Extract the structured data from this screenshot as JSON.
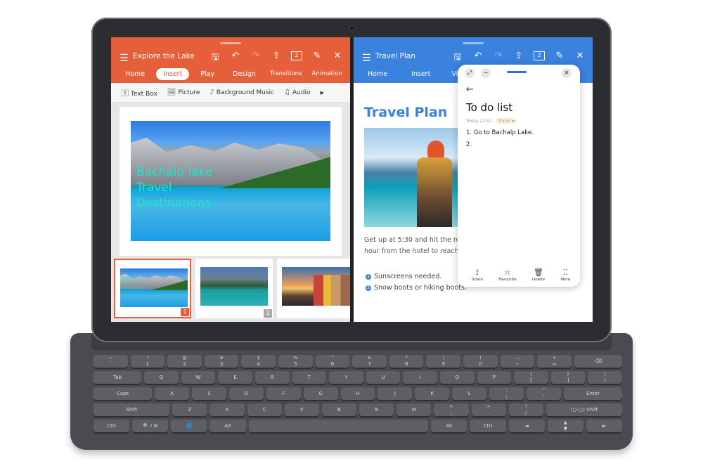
{
  "left_app": {
    "title": "Explore the Lake",
    "accent": "#E5603A",
    "header_icons": [
      "save-icon",
      "undo-icon",
      "redo-icon",
      "share-icon",
      "page-count-icon",
      "pen-icon",
      "close-icon"
    ],
    "page_count": "2",
    "tabs": [
      {
        "label": "Home"
      },
      {
        "label": "Insert",
        "active": true
      },
      {
        "label": "Play"
      },
      {
        "label": "Design"
      },
      {
        "label": "Transitions"
      },
      {
        "label": "Animation"
      }
    ],
    "toolbar": [
      {
        "label": "Text Box",
        "icon": "text-box-icon"
      },
      {
        "label": "Picture",
        "icon": "picture-icon"
      },
      {
        "label": "Background Music",
        "icon": "music-disc-icon"
      },
      {
        "label": "Audio",
        "icon": "audio-note-icon"
      }
    ],
    "slide": {
      "lines": [
        "Bachalp lake",
        "Travel",
        "Destinations"
      ]
    },
    "thumbnails": [
      {
        "number": "1",
        "selected": true,
        "lines": [
          "Bachalp lake",
          "Travel",
          "Destinations"
        ]
      },
      {
        "number": "2"
      },
      {
        "number": ""
      }
    ]
  },
  "right_app": {
    "title": "Travel Plan",
    "accent": "#3A82DE",
    "page_count": "2",
    "tabs": [
      {
        "label": "Home"
      },
      {
        "label": "Insert"
      },
      {
        "label": "View"
      }
    ],
    "doc": {
      "heading": "Travel Plan",
      "paragraph": [
        "Get up at 5:30 and hit the ro",
        "hour from the hotel to reach"
      ],
      "bullets": [
        {
          "n": "1",
          "text": "Sunscreens needed."
        },
        {
          "n": "2",
          "text": "Snow boots or hiking boots."
        }
      ]
    }
  },
  "note": {
    "title": "To do list",
    "date": "Today 21:52",
    "tag": "Travel",
    "items": [
      "1. Go to Bachalp Lake.",
      "2."
    ],
    "actions": [
      {
        "label": "Share",
        "glyph": "⟟"
      },
      {
        "label": "Favourite",
        "glyph": "☆"
      },
      {
        "label": "Delete",
        "glyph": "🗑"
      },
      {
        "label": "More",
        "glyph": "⁚⁚"
      }
    ]
  },
  "keyboard": {
    "rows": [
      [
        [
          "~",
          "`"
        ],
        [
          "!",
          "1"
        ],
        [
          "@",
          "2"
        ],
        [
          "#",
          "3"
        ],
        [
          "$",
          "4"
        ],
        [
          "%",
          "5"
        ],
        [
          "^",
          "6"
        ],
        [
          "&",
          "7"
        ],
        [
          "*",
          "8"
        ],
        [
          "(",
          "9"
        ],
        [
          ")",
          "0"
        ],
        [
          "—",
          "−"
        ],
        [
          "+",
          "="
        ],
        [
          "",
          "⌫"
        ]
      ],
      [
        [
          "",
          "Tab"
        ],
        [
          "",
          "Q"
        ],
        [
          "",
          "W"
        ],
        [
          "",
          "E"
        ],
        [
          "",
          "R"
        ],
        [
          "",
          "T"
        ],
        [
          "",
          "Y"
        ],
        [
          "",
          "U"
        ],
        [
          "",
          "I"
        ],
        [
          "",
          "O"
        ],
        [
          "",
          "P"
        ],
        [
          "{",
          "["
        ],
        [
          "}",
          "]"
        ],
        [
          "|",
          "\\"
        ]
      ],
      [
        [
          "",
          "Caps"
        ],
        [
          "",
          "A"
        ],
        [
          "",
          "S"
        ],
        [
          "",
          "D"
        ],
        [
          "",
          "F"
        ],
        [
          "",
          "G"
        ],
        [
          "",
          "H"
        ],
        [
          "",
          "J"
        ],
        [
          "",
          "K"
        ],
        [
          "",
          "L"
        ],
        [
          ":",
          ";"
        ],
        [
          "\"",
          "'"
        ],
        [
          "",
          "Enter"
        ]
      ],
      [
        [
          "",
          "Shift"
        ],
        [
          "",
          "Z"
        ],
        [
          "",
          "X"
        ],
        [
          "",
          "C"
        ],
        [
          "",
          "V"
        ],
        [
          "",
          "B"
        ],
        [
          "",
          "N"
        ],
        [
          "",
          "M"
        ],
        [
          "<",
          ","
        ],
        [
          ">",
          "."
        ],
        [
          "?",
          "/"
        ],
        [
          "",
          "(○-○)   Shift"
        ]
      ],
      [
        [
          "",
          "Ctrl"
        ],
        [
          "",
          "🔍 / ⊞"
        ],
        [
          "",
          "🌐"
        ],
        [
          "",
          "Alt"
        ],
        [
          "",
          ""
        ],
        [
          "",
          "Alt"
        ],
        [
          "",
          "Ctrl"
        ],
        [
          "",
          "◄"
        ],
        [
          "▲",
          "▼"
        ],
        [
          "",
          "►"
        ]
      ]
    ]
  }
}
